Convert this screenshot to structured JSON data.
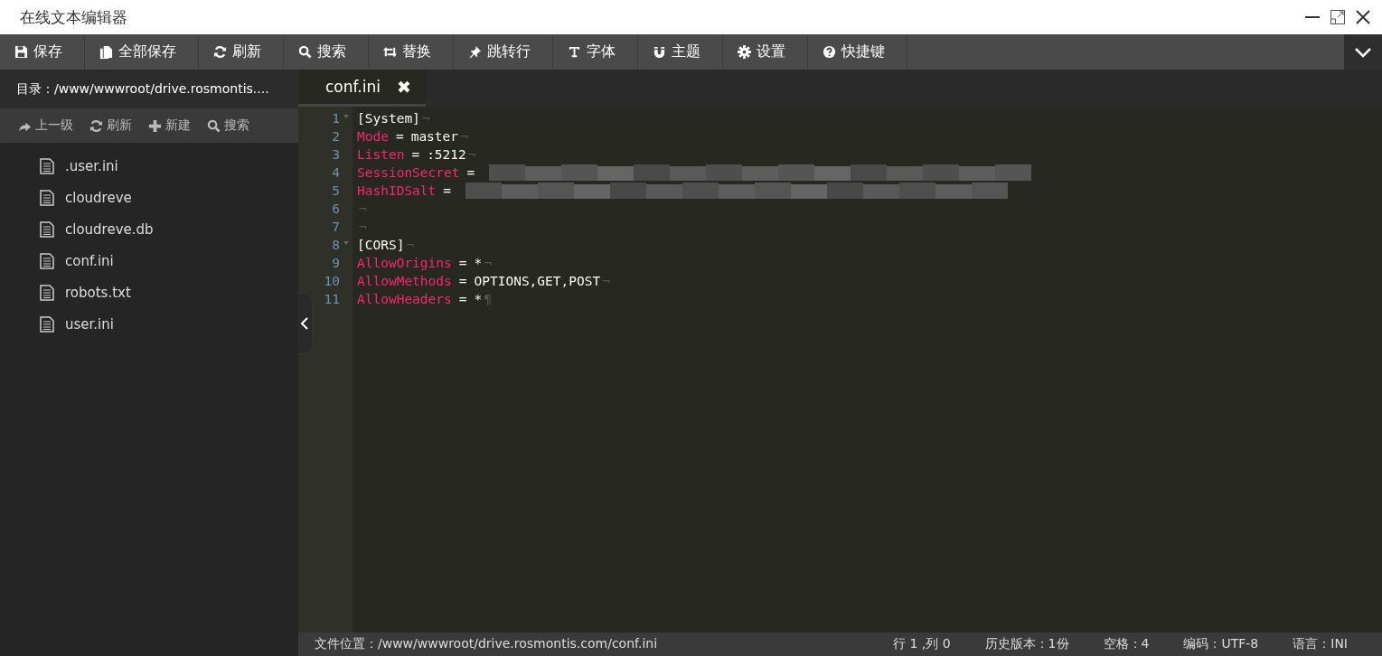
{
  "window": {
    "title": "在线文本编辑器"
  },
  "toolbar": [
    {
      "kind": "save",
      "label": "保存"
    },
    {
      "kind": "saveall",
      "label": "全部保存"
    },
    {
      "kind": "refresh",
      "label": "刷新"
    },
    {
      "kind": "search",
      "label": "搜索"
    },
    {
      "kind": "replace",
      "label": "替换"
    },
    {
      "kind": "goto",
      "label": "跳转行"
    },
    {
      "kind": "font",
      "label": "字体"
    },
    {
      "kind": "theme",
      "label": "主题"
    },
    {
      "kind": "settings",
      "label": "设置"
    },
    {
      "kind": "help",
      "label": "快捷键"
    }
  ],
  "sidebar": {
    "path": "目录：/www/wwwroot/drive.rosmontis....",
    "actions": [
      {
        "kind": "up",
        "label": "上一级"
      },
      {
        "kind": "refresh",
        "label": "刷新"
      },
      {
        "kind": "new",
        "label": "新建"
      },
      {
        "kind": "search",
        "label": "搜索"
      }
    ],
    "files": [
      {
        "name": ".user.ini"
      },
      {
        "name": "cloudreve"
      },
      {
        "name": "cloudreve.db"
      },
      {
        "name": "conf.ini"
      },
      {
        "name": "robots.txt"
      },
      {
        "name": "user.ini"
      }
    ]
  },
  "tabs": [
    {
      "label": "conf.ini",
      "close": "✖",
      "selected": true
    }
  ],
  "editor": {
    "lines": [
      {
        "number": "1",
        "foldable": true,
        "value": "[System]",
        "redacted": false,
        "eol": "¬"
      },
      {
        "number": "2",
        "foldable": false,
        "key": "Mode",
        "op": "=",
        "value": "master",
        "redacted": false,
        "eol": "¬"
      },
      {
        "number": "3",
        "foldable": false,
        "key": "Listen",
        "op": "=",
        "value": ":5212",
        "redacted": false,
        "eol": "¬"
      },
      {
        "number": "4",
        "foldable": false,
        "key": "SessionSecret",
        "op": "=",
        "redacted": true
      },
      {
        "number": "5",
        "foldable": false,
        "key": "HashIDSalt",
        "op": "=",
        "redacted": true
      },
      {
        "number": "6",
        "foldable": false,
        "redacted": false,
        "eol": "¬"
      },
      {
        "number": "7",
        "foldable": false,
        "redacted": false,
        "eol": "¬"
      },
      {
        "number": "8",
        "foldable": true,
        "value": "[CORS]",
        "redacted": false,
        "eol": "¬"
      },
      {
        "number": "9",
        "foldable": false,
        "key": "AllowOrigins",
        "op": "=",
        "value": "*",
        "redacted": false,
        "eol": "¬"
      },
      {
        "number": "10",
        "foldable": false,
        "key": "AllowMethods",
        "op": "=",
        "value": "OPTIONS,GET,POST",
        "redacted": false,
        "eol": "¬"
      },
      {
        "number": "11",
        "foldable": false,
        "key": "AllowHeaders",
        "op": "=",
        "value": "*",
        "redacted": false,
        "eol": "¶"
      }
    ]
  },
  "status_bar": {
    "file_path": "文件位置：/www/wwwroot/drive.rosmontis.com/conf.ini",
    "items": [
      "行 1 ,列 0",
      "历史版本：1份",
      "空格：4",
      "编码：UTF-8",
      "语言：INI"
    ]
  }
}
